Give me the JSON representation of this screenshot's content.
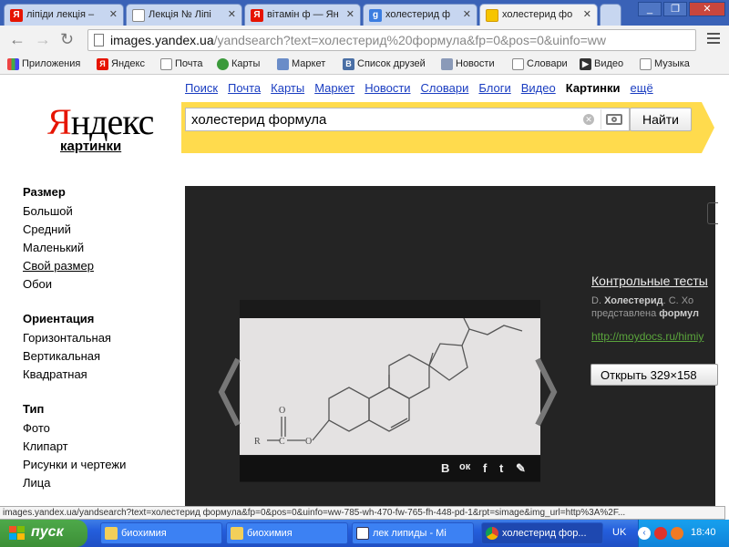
{
  "browser": {
    "tabs": [
      {
        "title": "ліпіди лекція – ",
        "favicon": "yandex-icon",
        "active": false
      },
      {
        "title": "Лекція № Ліпі",
        "favicon": "page-icon",
        "active": false
      },
      {
        "title": "вітамін ф — Ян",
        "favicon": "yandex-icon",
        "active": false
      },
      {
        "title": "холестерид ф",
        "favicon": "google-icon",
        "active": false
      },
      {
        "title": "холестерид фо",
        "favicon": "yandex-images-icon",
        "active": true
      }
    ],
    "url_host": "images.yandex.ua",
    "url_rest": "/yandsearch?text=холестерид%20формула&fp=0&pos=0&uinfo=ww",
    "bookmarks": [
      "Приложения",
      "Яндекс",
      "Почта",
      "Карты",
      "Маркет",
      "Список друзей",
      "Новости",
      "Словари",
      "Видео",
      "Музыка"
    ]
  },
  "yandex": {
    "logo_red": "Я",
    "logo_rest": "ндекс",
    "logo_sub": "картинки",
    "nav": [
      "Поиск",
      "Почта",
      "Карты",
      "Маркет",
      "Новости",
      "Словари",
      "Блоги",
      "Видео",
      "Картинки",
      "ещё"
    ],
    "current_nav": "Картинки",
    "search_value": "холестерид формула",
    "search_button": "Найти"
  },
  "sidebar": {
    "size_heading": "Размер",
    "size_items": [
      "Большой",
      "Средний",
      "Маленький",
      "Свой размер",
      "Обои"
    ],
    "orientation_heading": "Ориентация",
    "orientation_items": [
      "Горизонтальная",
      "Вертикальная",
      "Квадратная"
    ],
    "type_heading": "Тип",
    "type_items": [
      "Фото",
      "Клипарт",
      "Рисунки и чертежи",
      "Лица"
    ]
  },
  "viewer": {
    "title": "Контрольные тесты",
    "desc_line1_prefix": "D. ",
    "desc_line1_bold": "Холестерид",
    "desc_line1_suffix": ". С. Хо",
    "desc_line2_prefix": "представлена ",
    "desc_line2_bold": "формул",
    "source_link": "http://moydocs.ru/himiy",
    "open_button": "Открыть 329×158",
    "share_icons": [
      "В",
      "ок",
      "f",
      "t",
      "✎"
    ],
    "formula_label_r": "R",
    "formula_label_c": "C",
    "formula_label_o": "O"
  },
  "status_url": "images.yandex.ua/yandsearch?text=холестерид формула&fp=0&pos=0&uinfo=ww-785-wh-470-fw-765-fh-448-pd-1&rpt=simage&img_url=http%3A%2F...",
  "taskbar": {
    "start": "пуск",
    "tasks": [
      "биохимия",
      "биохимия",
      "лек липиды - Mi",
      "холестерид фор..."
    ],
    "lang": "UK",
    "time": "18:40"
  },
  "colors": {
    "yandex_red": "#e61400",
    "search_band": "#ffdb4d",
    "link_blue": "#1a3dc1",
    "viewer_bg": "#242424",
    "source_green": "#5aa43c"
  }
}
